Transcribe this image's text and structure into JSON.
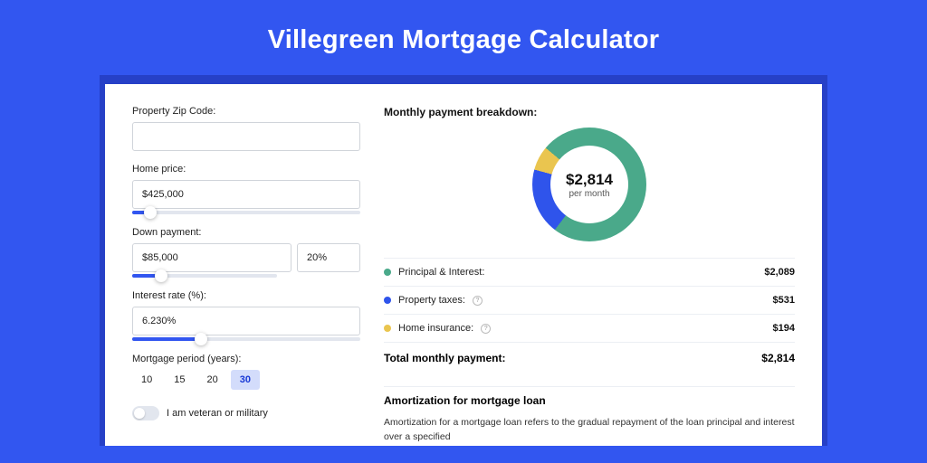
{
  "page_title": "Villegreen Mortgage Calculator",
  "colors": {
    "accent": "#3256f0",
    "green": "#4aa98a",
    "blue": "#2f54eb",
    "yellow": "#eac54f"
  },
  "form": {
    "zip": {
      "label": "Property Zip Code:",
      "value": ""
    },
    "home_price": {
      "label": "Home price:",
      "value": "$425,000",
      "slider_pct": 8
    },
    "down_payment": {
      "label": "Down payment:",
      "value": "$85,000",
      "pct": "20%",
      "slider_pct": 20
    },
    "interest": {
      "label": "Interest rate (%):",
      "value": "6.230%",
      "slider_pct": 30
    },
    "period": {
      "label": "Mortgage period (years):",
      "options": [
        "10",
        "15",
        "20",
        "30"
      ],
      "active": "30"
    },
    "veteran": {
      "label": "I am veteran or military",
      "on": false
    }
  },
  "breakdown": {
    "title": "Monthly payment breakdown:",
    "center_amount": "$2,814",
    "center_sub": "per month",
    "items": [
      {
        "label": "Principal & Interest:",
        "value": "$2,089",
        "color": "green",
        "info": false
      },
      {
        "label": "Property taxes:",
        "value": "$531",
        "color": "blue",
        "info": true
      },
      {
        "label": "Home insurance:",
        "value": "$194",
        "color": "yellow",
        "info": true
      }
    ],
    "total_label": "Total monthly payment:",
    "total_value": "$2,814"
  },
  "chart_data": {
    "type": "pie",
    "title": "Monthly payment breakdown",
    "series": [
      {
        "name": "Principal & Interest",
        "value": 2089,
        "color": "#4aa98a"
      },
      {
        "name": "Property taxes",
        "value": 531,
        "color": "#2f54eb"
      },
      {
        "name": "Home insurance",
        "value": 194,
        "color": "#eac54f"
      }
    ],
    "center_label": "$2,814 per month"
  },
  "amortization": {
    "title": "Amortization for mortgage loan",
    "text": "Amortization for a mortgage loan refers to the gradual repayment of the loan principal and interest over a specified"
  }
}
